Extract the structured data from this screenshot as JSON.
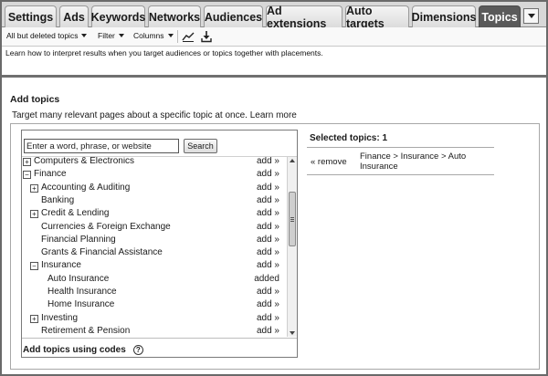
{
  "tabs": [
    {
      "label": "Settings",
      "active": false
    },
    {
      "label": "Ads",
      "active": false
    },
    {
      "label": "Keywords",
      "active": false
    },
    {
      "label": "Networks",
      "active": false
    },
    {
      "label": "Audiences",
      "active": false
    },
    {
      "label": "Ad extensions",
      "active": false
    },
    {
      "label": "Auto targets",
      "active": false
    },
    {
      "label": "Dimensions",
      "active": false
    },
    {
      "label": "Topics",
      "active": true
    }
  ],
  "toolbar": {
    "filter_view": "All but deleted topics",
    "filter": "Filter",
    "columns": "Columns",
    "icons": [
      "chart-icon",
      "download-icon"
    ]
  },
  "info_text": "Learn how to interpret results when you target audiences or topics together with placements.",
  "add_topics": {
    "title": "Add topics",
    "description": "Target many relevant pages about a specific topic at once.",
    "learn_more": "Learn more",
    "search_placeholder": "Enter a word, phrase, or website",
    "search_button": "Search",
    "items": [
      {
        "label": "Computers & Electronics",
        "level": 0,
        "toggle": "+",
        "action": "add »",
        "added": false
      },
      {
        "label": "Finance",
        "level": 0,
        "toggle": "−",
        "action": "add »",
        "added": false
      },
      {
        "label": "Accounting & Auditing",
        "level": 1,
        "toggle": "+",
        "action": "add »",
        "added": false
      },
      {
        "label": "Banking",
        "level": 1,
        "toggle": "",
        "action": "add »",
        "added": false
      },
      {
        "label": "Credit & Lending",
        "level": 1,
        "toggle": "+",
        "action": "add »",
        "added": false
      },
      {
        "label": "Currencies & Foreign Exchange",
        "level": 1,
        "toggle": "",
        "action": "add »",
        "added": false
      },
      {
        "label": "Financial Planning",
        "level": 1,
        "toggle": "",
        "action": "add »",
        "added": false
      },
      {
        "label": "Grants & Financial Assistance",
        "level": 1,
        "toggle": "",
        "action": "add »",
        "added": false
      },
      {
        "label": "Insurance",
        "level": 1,
        "toggle": "−",
        "action": "add »",
        "added": false
      },
      {
        "label": "Auto Insurance",
        "level": 2,
        "toggle": "",
        "action": "added",
        "added": true
      },
      {
        "label": "Health Insurance",
        "level": 2,
        "toggle": "",
        "action": "add »",
        "added": false
      },
      {
        "label": "Home Insurance",
        "level": 2,
        "toggle": "",
        "action": "add »",
        "added": false
      },
      {
        "label": "Investing",
        "level": 1,
        "toggle": "+",
        "action": "add »",
        "added": false
      },
      {
        "label": "Retirement & Pension",
        "level": 1,
        "toggle": "",
        "action": "add »",
        "added": false
      }
    ],
    "codes_link": "Add topics using codes",
    "help_glyph": "?"
  },
  "selected": {
    "title": "Selected topics: 1",
    "remove_label": "« remove",
    "path": "Finance > Insurance > Auto Insurance"
  }
}
